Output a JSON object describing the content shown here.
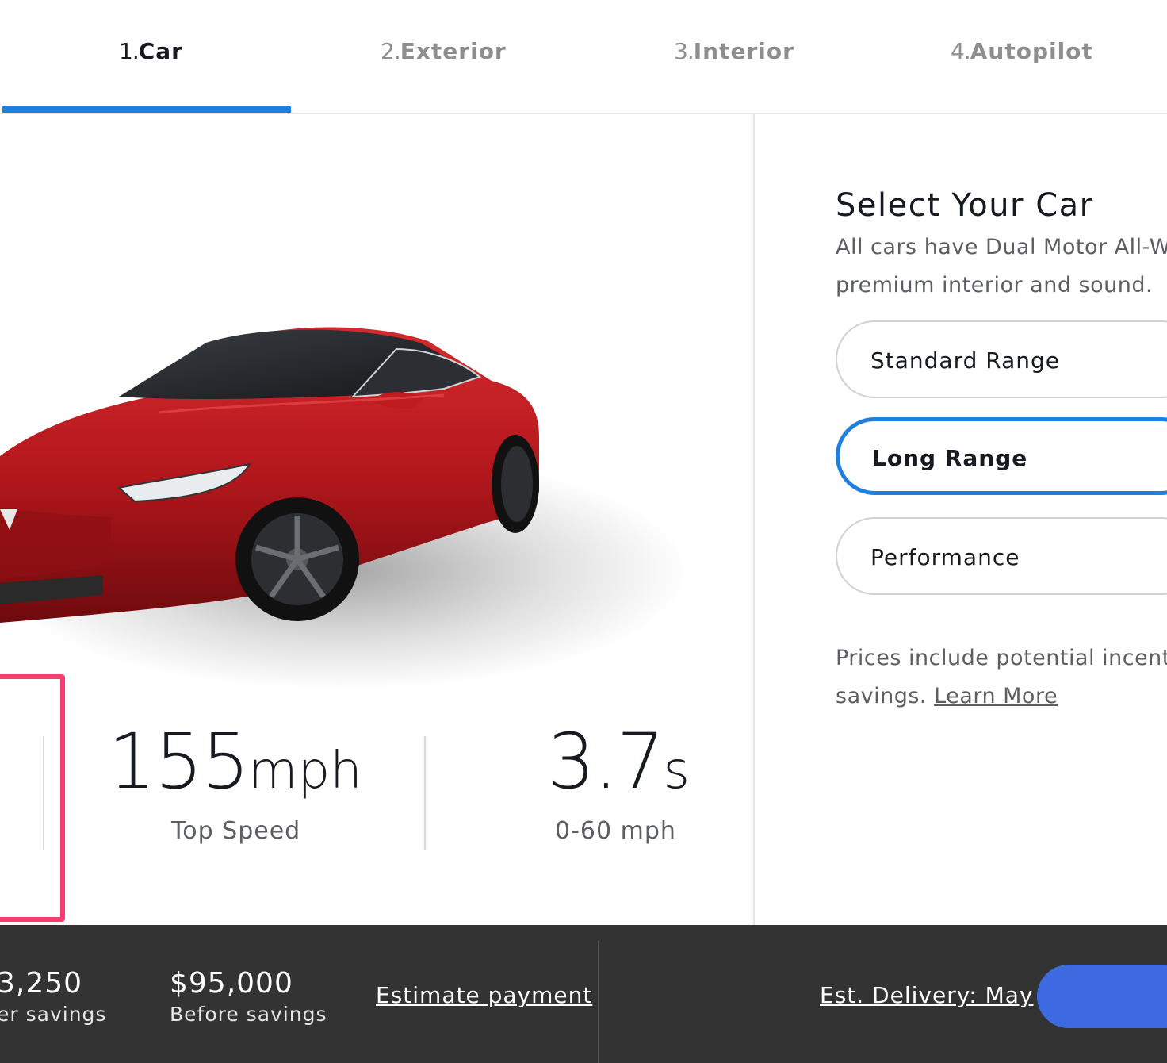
{
  "steps": [
    {
      "num": "1.",
      "label": "Car"
    },
    {
      "num": "2.",
      "label": "Exterior"
    },
    {
      "num": "3.",
      "label": "Interior"
    },
    {
      "num": "4.",
      "label": "Autopilot"
    }
  ],
  "stats": [
    {
      "value": "155",
      "unit": "mph",
      "label": "Top Speed"
    },
    {
      "value": "3.7",
      "unit": "s",
      "label": "0-60 mph"
    }
  ],
  "config": {
    "title": "Select Your Car",
    "description_line1": "All cars have Dual Motor All-W",
    "description_line2": "premium interior and sound.",
    "options": [
      "Standard Range",
      "Long Range",
      "Performance"
    ],
    "selected_option": "Long Range",
    "note_line1": "Prices include potential incent",
    "note_line2": "savings.",
    "learn_more": "Learn More"
  },
  "footer": {
    "after_savings_price": "3,250",
    "after_savings_label": "er savings",
    "before_savings_price": "$95,000",
    "before_savings_label": "Before savings",
    "estimate_payment": "Estimate payment",
    "delivery": "Est. Delivery: May"
  },
  "colors": {
    "accent_blue": "#1f7fe0",
    "car_red": "#b3171c",
    "highlight_pink": "#fa3b6e",
    "bar_bg": "#333333",
    "order_button": "#3e6ae1"
  }
}
